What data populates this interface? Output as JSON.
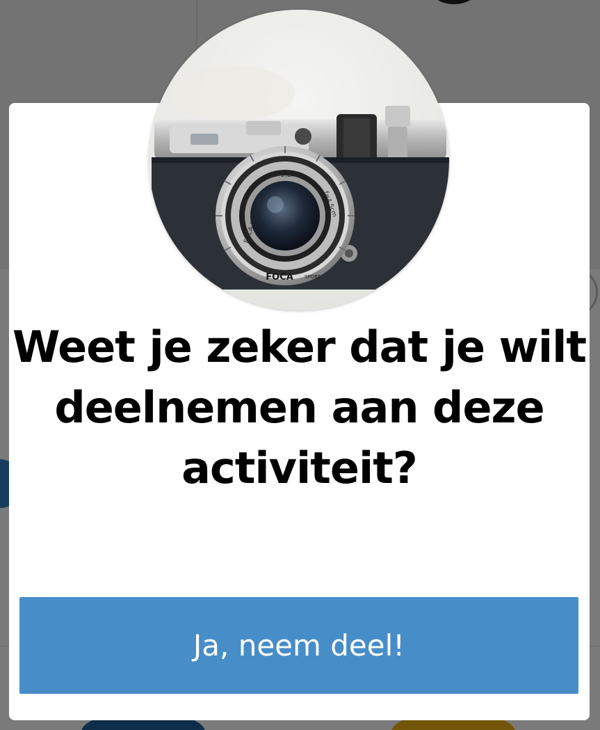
{
  "modal": {
    "image": {
      "icon": "camera-photo",
      "lens_text_top": "f=1:2.8",
      "lens_text_left": "FOCA-NEOPLAR",
      "lens_text_right": "f=4.5cm",
      "brand": "FOCA",
      "brand_sub": "SPORT"
    },
    "title": "Weet je zeker dat je wilt deelnemen aan deze activiteit?",
    "confirm_label": "Ja, neem deel!"
  },
  "colors": {
    "button_bg": "#478dc8",
    "button_text": "#ffffff",
    "title_text": "#000000",
    "overlay": "rgba(0,0,0,0.52)"
  }
}
